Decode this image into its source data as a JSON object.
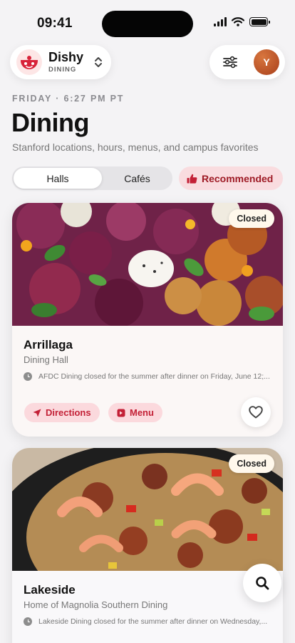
{
  "status_bar": {
    "time": "09:41"
  },
  "brand": {
    "name": "Dishy",
    "subtitle": "DINING"
  },
  "user": {
    "avatar_initial": "Y"
  },
  "header": {
    "date_line": "FRIDAY · 6:27 PM PT",
    "title": "Dining",
    "subtitle": "Stanford locations, hours, menus, and campus favorites"
  },
  "filters": {
    "segments": [
      "Halls",
      "Cafés"
    ],
    "active_segment": "Halls",
    "recommended_label": "Recommended"
  },
  "cards": [
    {
      "name": "Arrillaga",
      "type": "Dining Hall",
      "badge": "Closed",
      "status": "AFDC Dining closed for the summer after dinner on Friday, June 12;...",
      "directions_label": "Directions",
      "menu_label": "Menu",
      "favorited": false
    },
    {
      "name": "Lakeside",
      "type": "Home of Magnolia Southern Dining",
      "badge": "Closed",
      "status": "Lakeside Dining closed for the summer after dinner on Wednesday,..."
    }
  ],
  "colors": {
    "accent": "#c32036",
    "accent_soft": "#fbd9dd",
    "background": "#f4f3f5"
  },
  "icons": {
    "filter": "sliders-icon",
    "search": "search-icon",
    "favorite": "heart-icon",
    "directions": "location-arrow-icon",
    "menu": "menu-square-icon",
    "recommended": "thumbs-up-icon"
  }
}
